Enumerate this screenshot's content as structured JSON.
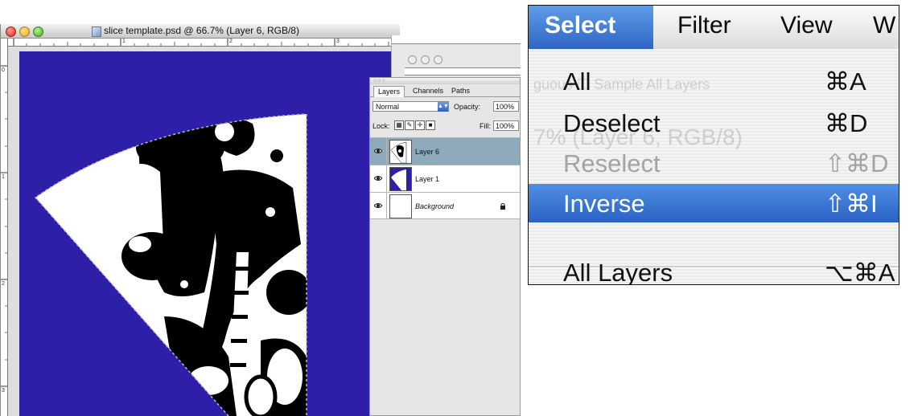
{
  "document_window": {
    "title": "slice template.psd @ 66.7% (Layer 6, RGB/8)",
    "ruler_marks_h": [
      "1",
      "2",
      "3"
    ],
    "ruler_marks_v": [
      "0",
      "1",
      "2",
      "3"
    ],
    "canvas_color": "#2e1fa8"
  },
  "layers_panel": {
    "tabs": [
      "Layers",
      "Channels",
      "Paths"
    ],
    "blend_mode": "Normal",
    "opacity_label": "Opacity:",
    "opacity_value": "100%",
    "lock_label": "Lock:",
    "fill_label": "Fill:",
    "fill_value": "100%",
    "layers": [
      {
        "name": "Layer 6",
        "selected": true
      },
      {
        "name": "Layer 1",
        "selected": false
      },
      {
        "name": "Background",
        "selected": false,
        "locked": true
      }
    ]
  },
  "menubar": {
    "items": [
      "Select",
      "Filter",
      "View",
      "W"
    ],
    "active": "Select",
    "accent_color": "#3a73d0"
  },
  "select_menu": {
    "items": [
      {
        "label": "All",
        "shortcut": "⌘A",
        "enabled": true
      },
      {
        "label": "Deselect",
        "shortcut": "⌘D",
        "enabled": true
      },
      {
        "label": "Reselect",
        "shortcut": "⇧⌘D",
        "enabled": false
      },
      {
        "label": "Inverse",
        "shortcut": "⇧⌘I",
        "enabled": true,
        "highlighted": true
      },
      {
        "label": "All Layers",
        "shortcut": "⌥⌘A",
        "enabled": true
      }
    ]
  }
}
